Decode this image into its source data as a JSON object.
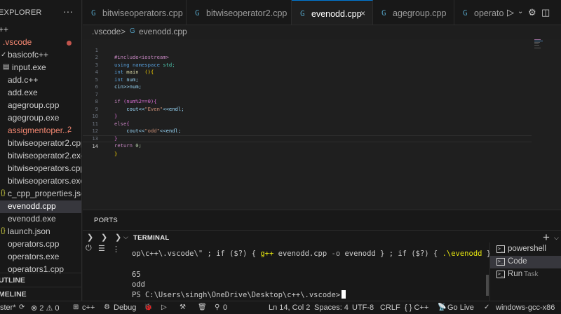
{
  "sidebar": {
    "title": "EXPLORER",
    "more": "···",
    "items": [
      {
        "icon": "",
        "label": "++"
      },
      {
        "icon": "",
        "label": ".vscode",
        "color": "#f48771"
      },
      {
        "icon": "✓",
        "label": "basicofc++"
      },
      {
        "icon": "",
        "label": "input.exe"
      },
      {
        "icon": "",
        "label": "add.c++"
      },
      {
        "icon": "",
        "label": "add.exe"
      },
      {
        "icon": "",
        "label": "agegroup.cpp"
      },
      {
        "icon": "",
        "label": "agegroup.exe"
      },
      {
        "icon": "",
        "label": "assigmentoper...",
        "color": "#f48771",
        "badge": "2"
      },
      {
        "icon": "",
        "label": "bitwiseoperator2.cpp"
      },
      {
        "icon": "",
        "label": "bitwiseoperator2.exe"
      },
      {
        "icon": "",
        "label": "bitwiseoperators.cpp"
      },
      {
        "icon": "",
        "label": "bitwiseoperators.exe"
      },
      {
        "icon": "{}",
        "label": "c_cpp_properties.json"
      },
      {
        "icon": "",
        "label": "evenodd.cpp"
      },
      {
        "icon": "",
        "label": "evenodd.exe"
      },
      {
        "icon": "{}",
        "label": "launch.json"
      },
      {
        "icon": "",
        "label": "operators.cpp"
      },
      {
        "icon": "",
        "label": "operators.exe"
      },
      {
        "icon": "",
        "label": "operators1.cpp"
      }
    ],
    "outline": "UTLINE",
    "timeline": "MELINE"
  },
  "tabs": [
    {
      "icon": "G",
      "label": "bitwiseoperators.cpp"
    },
    {
      "icon": "G",
      "label": "bitwiseoperator2.cpp"
    },
    {
      "icon": "G",
      "label": "evenodd.cpp",
      "close": "×"
    },
    {
      "icon": "G",
      "label": "agegroup.cpp"
    },
    {
      "icon": "G",
      "label": "operator"
    }
  ],
  "breadcrumb": {
    "folder": ".vscode",
    "sep": ">",
    "file": "evenodd.cpp"
  },
  "editor": {
    "lines": [
      "1",
      "2",
      "3",
      "4",
      "5",
      "6",
      "7",
      "8",
      "9",
      "10",
      "11",
      "12",
      "13",
      "14"
    ],
    "code": {
      "l1": "#include<iostream>",
      "l2a": "using",
      "l2b": " namespace",
      "l2c": " std;",
      "l3a": "int",
      "l3b": " main",
      "l3c": "  ()",
      "l3d": "{",
      "l4a": "int",
      "l4b": " num;",
      "l5": "cin>>num;",
      "l7a": "if",
      "l7b": " (num%2==0)",
      "l7c": "{",
      "l8a": "    cout<<",
      "l8b": "\"Even\"",
      "l8c": "<<endl;",
      "l9": "}",
      "l10a": "else",
      "l10b": "{",
      "l11a": "    cout<<",
      "l11b": "\"odd\"",
      "l11c": "<<endl;",
      "l12": "}",
      "l13a": "return",
      "l13b": " 0;",
      "l14": "}"
    }
  },
  "panel": {
    "ports": "PORTS",
    "terminal": "TERMINAL",
    "plus": "+",
    "cmd": {
      "a": "op\\c++\\.vscode\\\" ; ",
      "b": "if",
      "c": " ($?) { ",
      "d": "g++",
      "e": " evenodd.cpp ",
      "f": "-o",
      "g": " evenodd } ; ",
      "h": "if",
      "i": " ($?) { ",
      "j": ".\\evenodd",
      "k": " }"
    },
    "out1": "65",
    "out2": "odd",
    "prompt": "PS C:\\Users\\singh\\OneDrive\\Desktop\\c++\\.vscode>",
    "terminals": [
      {
        "icon": ">_",
        "label": "powershell",
        "sub": ""
      },
      {
        "icon": ">_",
        "label": "Code",
        "sub": ""
      },
      {
        "icon": ">_",
        "label": "Run",
        "sub": "Task"
      }
    ]
  },
  "statusbar": {
    "branch": "ster*",
    "errors": "⊗ 2 ⚠ 0",
    "lang_c": "c++",
    "debug": "Debug",
    "zero": "0",
    "position": "Ln 14, Col 2",
    "spaces": "Spaces: 4",
    "encoding": "UTF-8",
    "eol": "CRLF",
    "mode": "{ } C++",
    "golive": "Go Live",
    "compiler": "windows-gcc-x86"
  }
}
